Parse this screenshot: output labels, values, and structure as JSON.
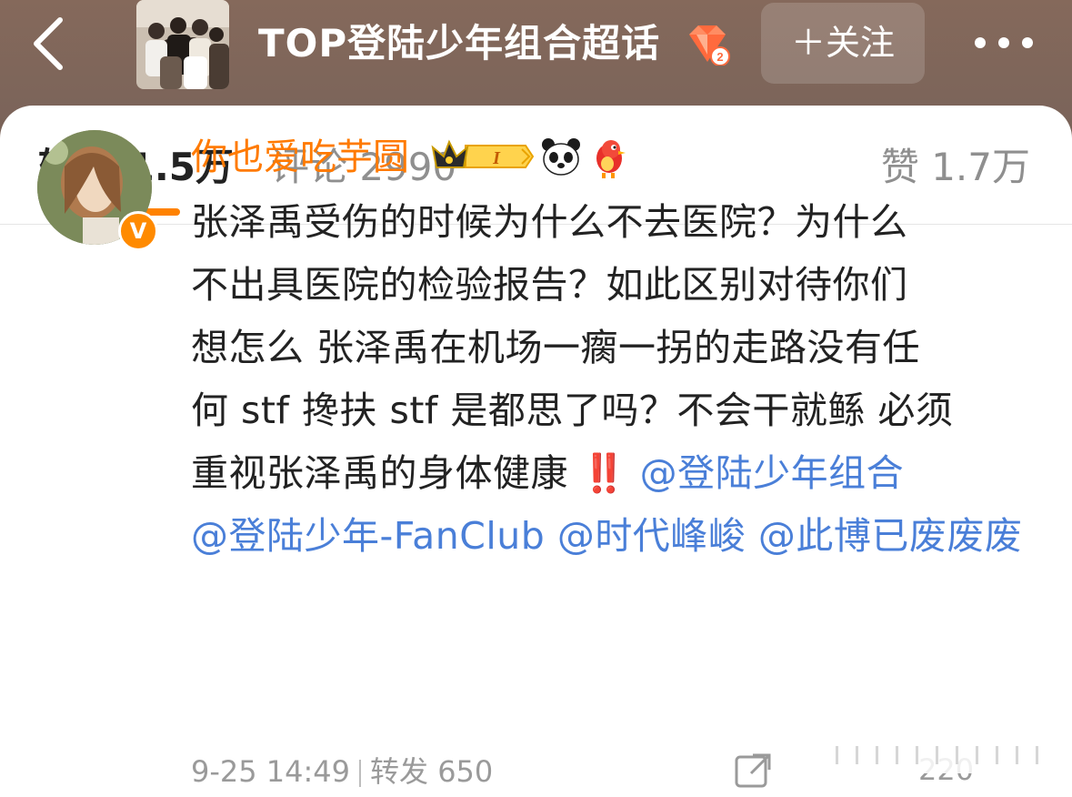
{
  "header": {
    "title": "TOP登陆少年组合超话",
    "follow_label": "＋关注",
    "back_icon": "chevron-left-icon",
    "badge_icon": "diamond-level-badge-icon",
    "more_icon": "more-dots-icon",
    "background_color": "#7b645a"
  },
  "tabs": {
    "repost": "转发 1.5万",
    "comment": "评论 2990",
    "like": "赞 1.7万",
    "active": "repost",
    "accent_color": "#ff8200"
  },
  "post": {
    "username": "你也爱吃芋圆",
    "username_color": "#ff7a00",
    "verified_badge_label": "V",
    "body_lines": [
      "张泽禹受伤的时候为什么不去医院？为什么",
      "不出具医院的检验报告？如此区别对待你们",
      "想怎么 张泽禹在机场一瘸一拐的走路没有任",
      "何 stf 搀扶 stf 是都思了吗？不会干就鲧 必须",
      "重视张泽禹的身体健康 "
    ],
    "exclamation": "‼️",
    "mentions": [
      "@登陆少年组合",
      "@登陆少年-FanClub",
      "@时代峰峻",
      "@此博已废废废"
    ],
    "mention_color": "#4a7fd8",
    "meta_date": "9-25 14:49",
    "meta_repost": "转发 650",
    "like_count": "220"
  }
}
